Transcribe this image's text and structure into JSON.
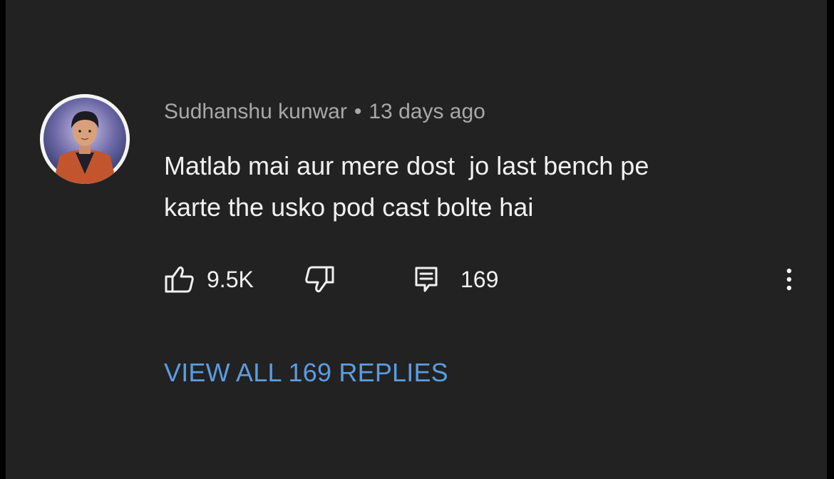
{
  "comment": {
    "author": "Sudhanshu kunwar",
    "separator": "•",
    "timestamp": "13 days ago",
    "text_lines": [
      "Matlab mai aur mere dost  jo last bench pe",
      "karte the usko pod cast bolte hai"
    ],
    "likes": "9.5K",
    "reply_count": "169",
    "view_replies_label": "VIEW ALL 169 REPLIES"
  },
  "icons": {
    "like": "thumbs-up-icon",
    "dislike": "thumbs-down-icon",
    "reply": "comment-icon",
    "more": "more-vertical-icon",
    "avatar": "user-avatar"
  },
  "colors": {
    "background": "#222222",
    "text_primary": "#f1f1f1",
    "text_secondary": "#a8a8a8",
    "link": "#5b9de0"
  }
}
